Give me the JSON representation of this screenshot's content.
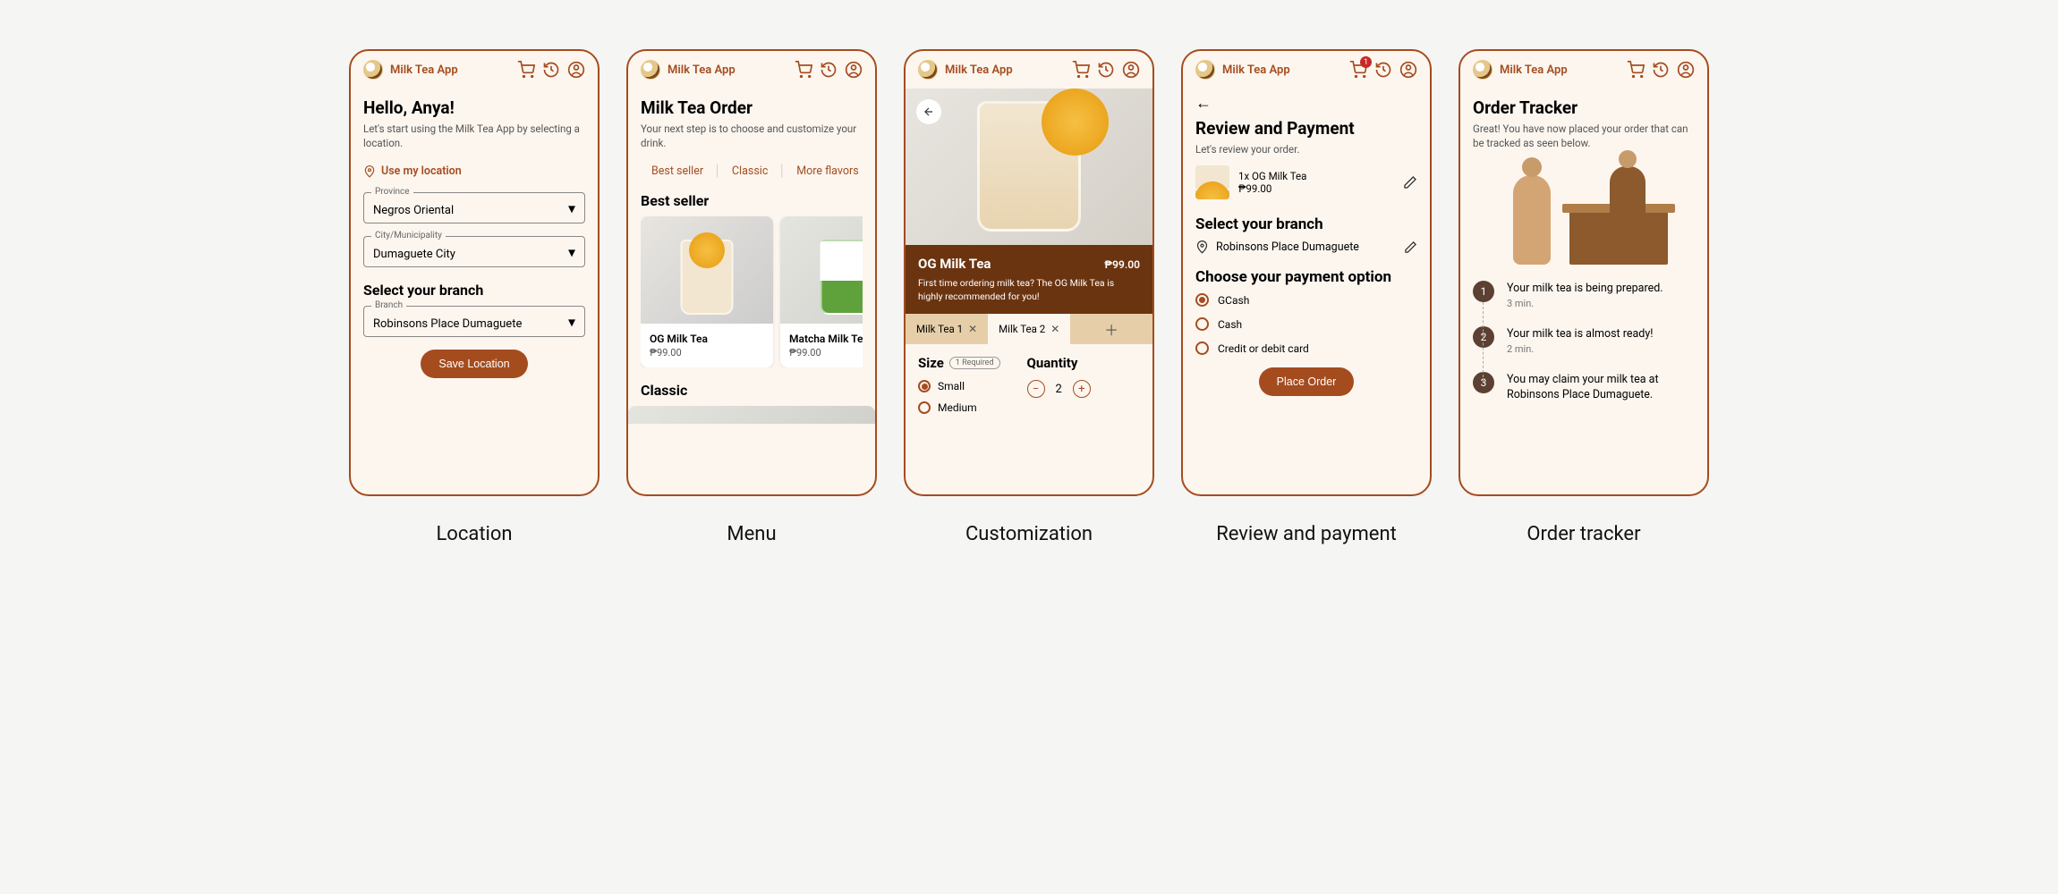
{
  "app_name": "Milk Tea App",
  "colors": {
    "accent": "#A54C1F",
    "brand_bg": "#6B3410"
  },
  "screens": {
    "location": {
      "caption": "Location",
      "title": "Hello, Anya!",
      "subtitle": "Let's start using the Milk Tea App by selecting a location.",
      "use_location": "Use my location",
      "fields": {
        "province": {
          "label": "Province",
          "value": "Negros Oriental"
        },
        "city": {
          "label": "City/Municipality",
          "value": "Dumaguete City"
        },
        "branch_heading": "Select your branch",
        "branch": {
          "label": "Branch",
          "value": "Robinsons Place Dumaguete"
        }
      },
      "save_btn": "Save Location"
    },
    "menu": {
      "caption": "Menu",
      "title": "Milk Tea Order",
      "subtitle": "Your next step is to choose and customize your drink.",
      "filters": [
        "Best seller",
        "Classic",
        "More flavors"
      ],
      "section_best": "Best seller",
      "section_classic": "Classic",
      "items": [
        {
          "name": "OG Milk Tea",
          "price": "₱99.00"
        },
        {
          "name": "Matcha Milk Tea",
          "price": "₱99.00"
        }
      ]
    },
    "custom": {
      "caption": "Customization",
      "product": {
        "name": "OG Milk Tea",
        "price": "₱99.00",
        "desc": "First time ordering milk tea? The OG Milk Tea is highly recommended for you!"
      },
      "tabs": [
        "Milk Tea 1",
        "Milk Tea 2"
      ],
      "size_heading": "Size",
      "size_req": "1 Required",
      "sizes": [
        "Small",
        "Medium"
      ],
      "size_selected": "Small",
      "qty_heading": "Quantity",
      "qty_value": "2"
    },
    "review": {
      "caption": "Review and payment",
      "title": "Review and Payment",
      "subtitle": "Let's review your order.",
      "cart_badge": "1",
      "line": {
        "label": "1x OG Milk Tea",
        "price": "₱99.00"
      },
      "branch_heading": "Select your branch",
      "branch": "Robinsons Place Dumaguete",
      "payment_heading": "Choose your payment option",
      "options": [
        "GCash",
        "Cash",
        "Credit or debit card"
      ],
      "selected": "GCash",
      "place_btn": "Place Order"
    },
    "tracker": {
      "caption": "Order tracker",
      "title": "Order Tracker",
      "subtitle": "Great! You have now placed your order that can be tracked as seen below.",
      "steps": [
        {
          "n": "1",
          "text": "Your milk tea is being prepared.",
          "time": "3 min."
        },
        {
          "n": "2",
          "text": "Your milk tea is almost ready!",
          "time": "2 min."
        },
        {
          "n": "3",
          "text": "You may claim your milk tea at Robinsons Place Dumaguete.",
          "time": ""
        }
      ]
    }
  }
}
